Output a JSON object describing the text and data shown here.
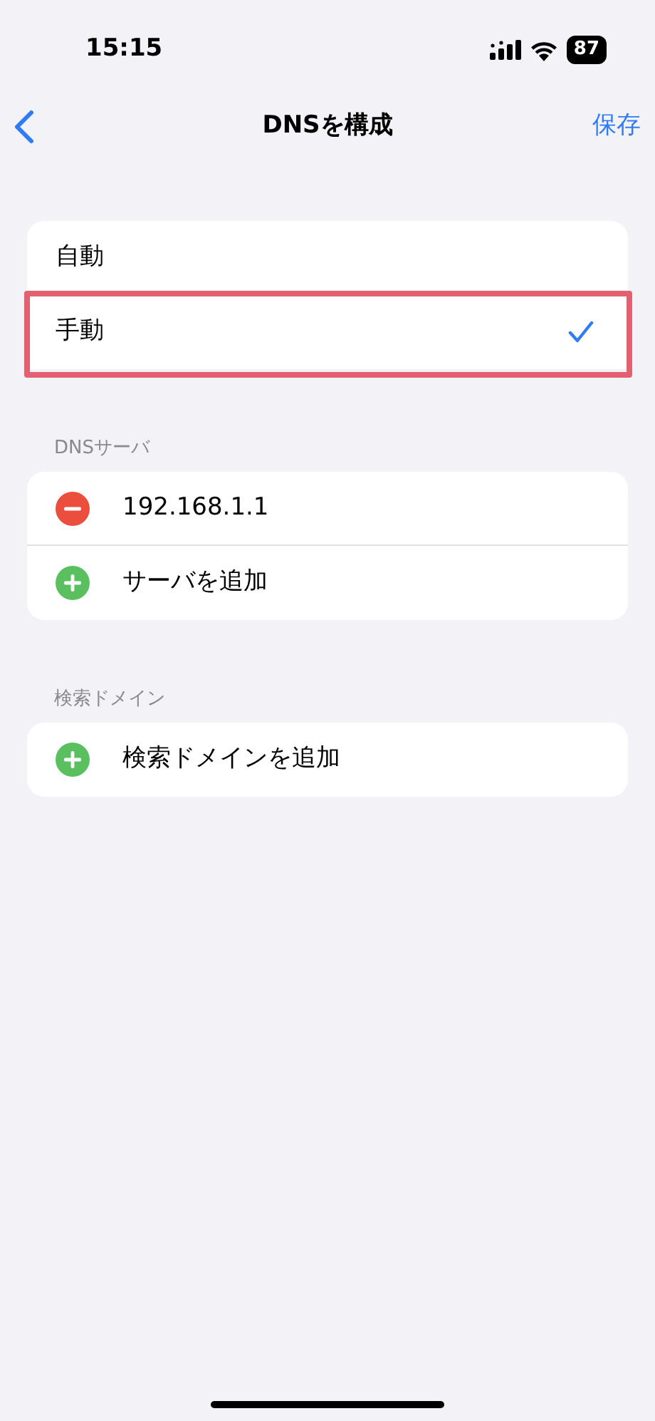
{
  "status_bar": {
    "time": "15:15",
    "battery": "87"
  },
  "nav": {
    "title": "DNSを構成",
    "action": "保存"
  },
  "mode_options": [
    {
      "label": "自動",
      "selected": false,
      "highlighted": false
    },
    {
      "label": "手動",
      "selected": true,
      "highlighted": true
    }
  ],
  "dns_servers": {
    "header": "DNSサーバ",
    "items": [
      {
        "kind": "remove",
        "label": "192.168.1.1"
      },
      {
        "kind": "add",
        "label": "サーバを追加"
      }
    ]
  },
  "search_domains": {
    "header": "検索ドメイン",
    "items": [
      {
        "kind": "add",
        "label": "検索ドメインを追加"
      }
    ]
  }
}
